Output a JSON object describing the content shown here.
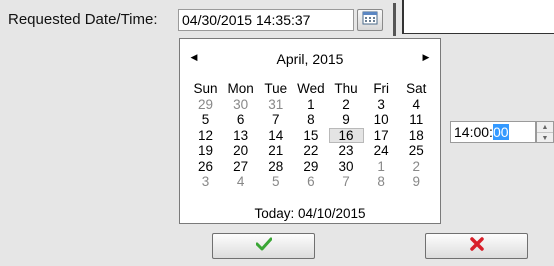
{
  "form": {
    "label": "Requested Date/Time:",
    "date_value": "04/30/2015 14:35:37",
    "time_prefix": "14:00:",
    "time_selected": "00"
  },
  "calendar": {
    "month_title": "April, 2015",
    "weekdays": [
      "Sun",
      "Mon",
      "Tue",
      "Wed",
      "Thu",
      "Fri",
      "Sat"
    ],
    "weeks": [
      [
        "29",
        "30",
        "31",
        "1",
        "2",
        "3",
        "4"
      ],
      [
        "5",
        "6",
        "7",
        "8",
        "9",
        "10",
        "11"
      ],
      [
        "12",
        "13",
        "14",
        "15",
        "16",
        "17",
        "18"
      ],
      [
        "19",
        "20",
        "21",
        "22",
        "23",
        "24",
        "25"
      ],
      [
        "26",
        "27",
        "28",
        "29",
        "30",
        "1",
        "2"
      ],
      [
        "3",
        "4",
        "5",
        "6",
        "7",
        "8",
        "9"
      ]
    ],
    "other_month": [
      [
        true,
        true,
        true,
        false,
        false,
        false,
        false
      ],
      [
        false,
        false,
        false,
        false,
        false,
        false,
        false
      ],
      [
        false,
        false,
        false,
        false,
        false,
        false,
        false
      ],
      [
        false,
        false,
        false,
        false,
        false,
        false,
        false
      ],
      [
        false,
        false,
        false,
        false,
        false,
        true,
        true
      ],
      [
        true,
        true,
        true,
        true,
        true,
        true,
        true
      ]
    ],
    "selected_day": "16",
    "today_text": "Today: 04/10/2015"
  },
  "icons": {
    "ok": "green-checkmark-icon",
    "cancel": "red-x-icon",
    "calendar": "calendar-icon"
  },
  "colors": {
    "ok_green": "#3aa635",
    "cancel_red": "#d8202a",
    "selection_blue": "#3399ff"
  }
}
